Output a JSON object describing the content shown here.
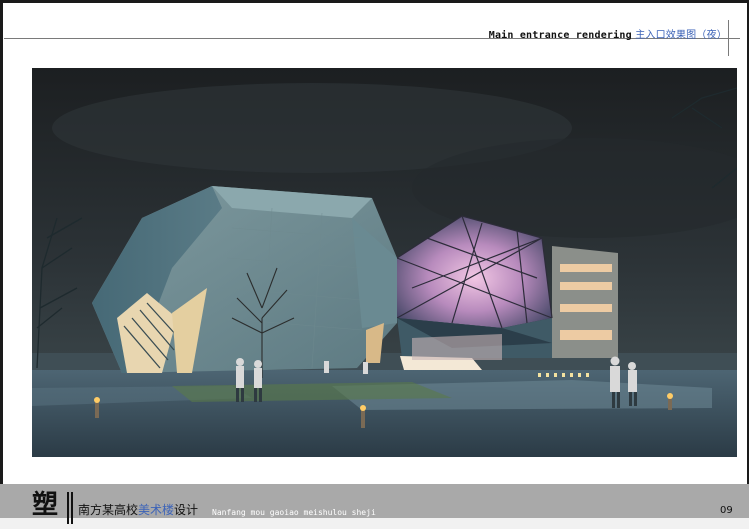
{
  "header": {
    "title_en": "Main entrance rendering",
    "title_zh": "主入口效果图（夜）"
  },
  "footer": {
    "logo_char": "塑",
    "title_part1": "南方某高校",
    "title_part2": "美术楼",
    "title_part3": "设计",
    "pinyin": "Nanfang mou gaoiao meishulou sheji",
    "page_number": "09"
  },
  "colors": {
    "accent_blue": "#3c63b8",
    "footer_band": "#a9a9a9"
  }
}
